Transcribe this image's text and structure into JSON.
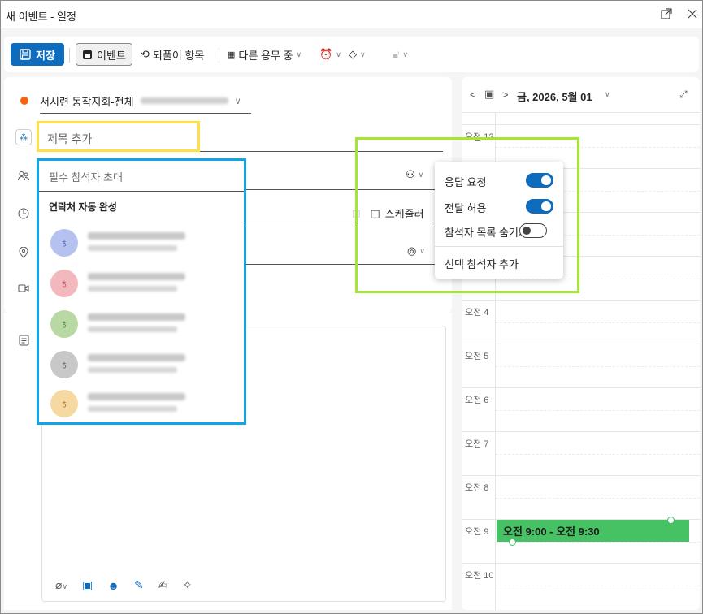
{
  "window": {
    "title": "새 이벤트 - 일정"
  },
  "toolbar": {
    "save_label": "저장",
    "event_label": "이벤트",
    "repeat_label": "되풀이 항목",
    "busy_label": "다른 용무 중"
  },
  "form": {
    "calendar_name": "서시련 동작지회-전체",
    "title_placeholder": "제목 추가",
    "attendee_placeholder": "필수 참석자 초대",
    "scheduler_label": "스케줄러"
  },
  "autocomplete": {
    "header": "연락처 자동 완성",
    "avatar_colors": [
      "#b5c2f0",
      "#f2b8bd",
      "#b9d9a4",
      "#c8c8c8",
      "#f5d9a0"
    ]
  },
  "attendee_menu": {
    "items": [
      {
        "label": "응답 요청",
        "toggle": "on"
      },
      {
        "label": "전달 허용",
        "toggle": "on"
      },
      {
        "label": "참석자 목록 숨기기",
        "toggle": "off"
      },
      {
        "label": "선택 참석자 추가"
      }
    ]
  },
  "calendar": {
    "date_label": "금, 2026, 5월 01",
    "hours": [
      "오전 12",
      "",
      "",
      "",
      "오전 4",
      "오전 5",
      "오전 6",
      "오전 7",
      "오전 8",
      "오전 9",
      "오전 10"
    ],
    "appointment": "오전 9:00 - 오전 9:30"
  },
  "colors": {
    "accent": "#0f6cbd",
    "appointment": "#46c164",
    "calendar_dot": "#f7630c"
  }
}
